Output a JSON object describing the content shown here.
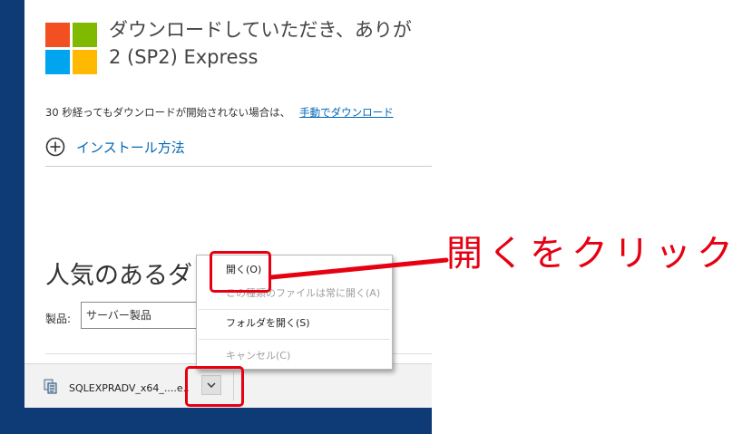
{
  "page": {
    "headline_line1": "ダウンロードしていただき、ありが",
    "headline_line2": "2 (SP2) Express",
    "notice_text": "30 秒経ってもダウンロードが開始されない場合は、",
    "notice_link": "手動でダウンロード",
    "install_label": "インストール方法",
    "popular_title": "人気のあるダ",
    "product_label": "製品:",
    "product_select_value": "サーバー製品"
  },
  "download_shelf": {
    "file_name": "SQLEXPRADV_x64_....e...",
    "file_icon": "installer-icon",
    "chevron_icon": "chevron-down-icon"
  },
  "context_menu": {
    "items": [
      {
        "label": "開く(O)",
        "enabled": true
      },
      {
        "label": "この種類のファイルは常に開く(A)",
        "enabled": false
      },
      {
        "label": "フォルダを開く(S)",
        "enabled": true
      },
      {
        "label": "キャンセル(C)",
        "enabled": false
      }
    ]
  },
  "annotation": {
    "text": "開くをクリック",
    "color": "#e60012"
  },
  "colors": {
    "desktop": "#0e3a75",
    "link": "#0067b8",
    "logo": [
      "#f25022",
      "#7fba00",
      "#00a4ef",
      "#ffb900"
    ]
  }
}
